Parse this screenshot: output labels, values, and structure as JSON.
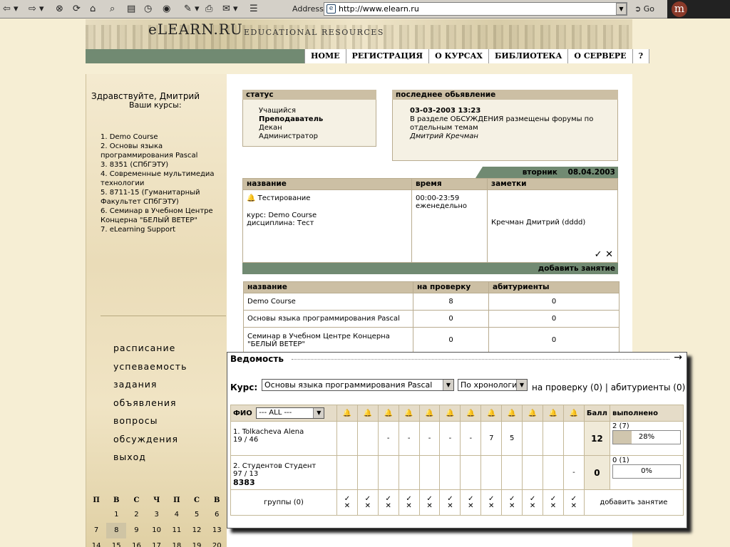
{
  "browser": {
    "address_label": "Address",
    "url": "http://www.elearn.ru",
    "go_label": "Go",
    "logo_letter": "m"
  },
  "header": {
    "site_title": "eLEARN.RU",
    "site_subtitle": "EDUCATIONAL RESOURCES",
    "nav": [
      "HOME",
      "РЕГИСТРАЦИЯ",
      "О КУРСАХ",
      "БИБЛИОТЕКА",
      "О СЕРВЕРЕ",
      "?"
    ]
  },
  "sidebar": {
    "greeting": "Здравствуйте, Дмитрий",
    "your_courses": "Ваши курсы:",
    "courses": [
      "1. Demo Course",
      "2. Основы языка программирования Pascal",
      "3. 8351 (СПбГЭТУ)",
      "4. Современные мультимедиа технологии",
      "5. 8711-15 (Гуманитарный Факультет СПбГЭТУ)",
      "6. Семинар в Учебном Центре Концерна \"БЕЛЫЙ ВЕТЕР\"",
      "7. eLearning Support"
    ],
    "menu": [
      "расписание",
      "успеваемость",
      "задания",
      "объявления",
      "вопросы",
      "обсуждения",
      "выход"
    ],
    "calendar": {
      "days": [
        "П",
        "В",
        "С",
        "Ч",
        "П",
        "С",
        "В"
      ],
      "rows": [
        [
          "",
          "1",
          "2",
          "3",
          "4",
          "5",
          "6"
        ],
        [
          "7",
          "8",
          "9",
          "10",
          "11",
          "12",
          "13"
        ],
        [
          "14",
          "15",
          "16",
          "17",
          "18",
          "19",
          "20"
        ]
      ],
      "today": "8"
    }
  },
  "status": {
    "title": "статус",
    "items": [
      "Учащийся",
      "Преподаватель",
      "Декан",
      "Администратор"
    ],
    "active": "Преподаватель"
  },
  "announcement": {
    "title": "последнее обьявление",
    "date": "03-03-2003 13:23",
    "text": "В разделе ОБСУЖДЕНИЯ размещены форумы по отдельным темам",
    "author": "Дмитрий Кречман"
  },
  "date_band": {
    "day": "вторник",
    "date": "08.04.2003"
  },
  "schedule": {
    "headers": [
      "название",
      "время",
      "заметки"
    ],
    "event": "Тестирование",
    "course_line": "курс: Demo Course",
    "discipline_line": "дисциплина: Тест",
    "time": "00:00-23:59",
    "repeat": "еженедельно",
    "notes": "Кречман Дмитрий (dddd)",
    "check": "✓",
    "cross": "✕",
    "add_label": "добавить занятие"
  },
  "courses_table": {
    "headers": [
      "название",
      "на проверку",
      "абитуриенты"
    ],
    "rows": [
      {
        "name": "Demo Course",
        "review": "8",
        "applicants": "0"
      },
      {
        "name": "Основы языка программирования Pascal",
        "review": "0",
        "applicants": "0"
      },
      {
        "name": "Семинар в Учебном Центре Концерна \"БЕЛЫЙ ВЕТЕР\"",
        "review": "0",
        "applicants": "0"
      }
    ]
  },
  "vedomost": {
    "title": "Ведомость",
    "arrow": "→",
    "course_label": "Курс:",
    "course_value": "Основы языка программирования Pascal",
    "order_value": "По хронологии",
    "count_info": "на проверку (0) | абитуриенты (0)",
    "fio_label": "ФИО",
    "group_filter": "--- ALL ---",
    "score_label": "Балл",
    "done_label": "выполнено",
    "bell": "🔔",
    "students": [
      {
        "name": "1. Tolkacheva Alena",
        "ratio": "19 / 46",
        "extra": "",
        "marks": [
          "",
          "",
          "-",
          "-",
          "-",
          "-",
          "-",
          "7",
          "5",
          "",
          "",
          ""
        ],
        "score": "12",
        "done": "2 (7)",
        "percent": 28,
        "percent_label": "28%"
      },
      {
        "name": "2. Студентов Студент",
        "ratio": "97 / 13",
        "extra": "8383",
        "marks": [
          "",
          "",
          "",
          "",
          "",
          "",
          "",
          "",
          "",
          "",
          "",
          "-"
        ],
        "score": "0",
        "done": "0 (1)",
        "percent": 0,
        "percent_label": "0%"
      }
    ],
    "groups_label": "группы (0)",
    "add_label": "добавить занятие"
  }
}
